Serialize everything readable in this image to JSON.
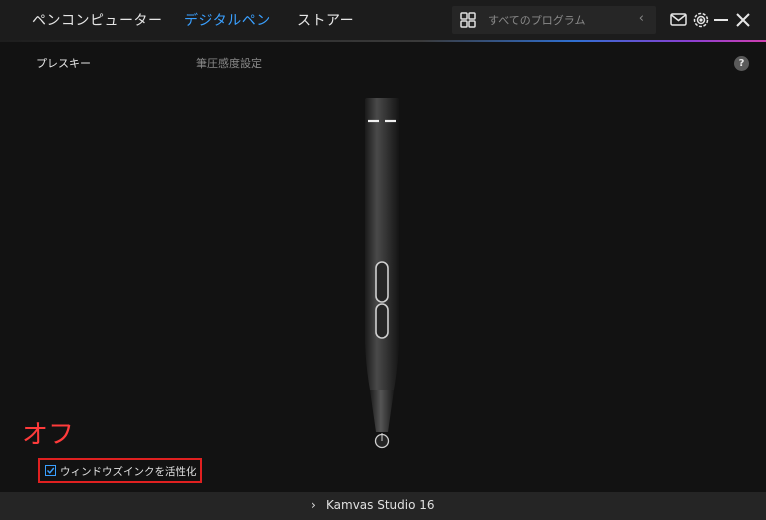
{
  "nav": {
    "tabs": [
      {
        "label": "ペンコンピューター"
      },
      {
        "label": "デジタルペン"
      },
      {
        "label": "ストアー"
      }
    ],
    "active_color": "#3aa0ff"
  },
  "search": {
    "label": "すべてのプログラム"
  },
  "subnav": {
    "items": [
      {
        "label": "プレスキー"
      },
      {
        "label": "筆圧感度設定"
      }
    ]
  },
  "help": {
    "label": "?"
  },
  "annotation": {
    "text": "オフ",
    "color": "#ff3b3b"
  },
  "windows_ink": {
    "label": "ウィンドウズインクを活性化",
    "checked": true
  },
  "footer": {
    "device_name": "Kamvas Studio 16"
  }
}
